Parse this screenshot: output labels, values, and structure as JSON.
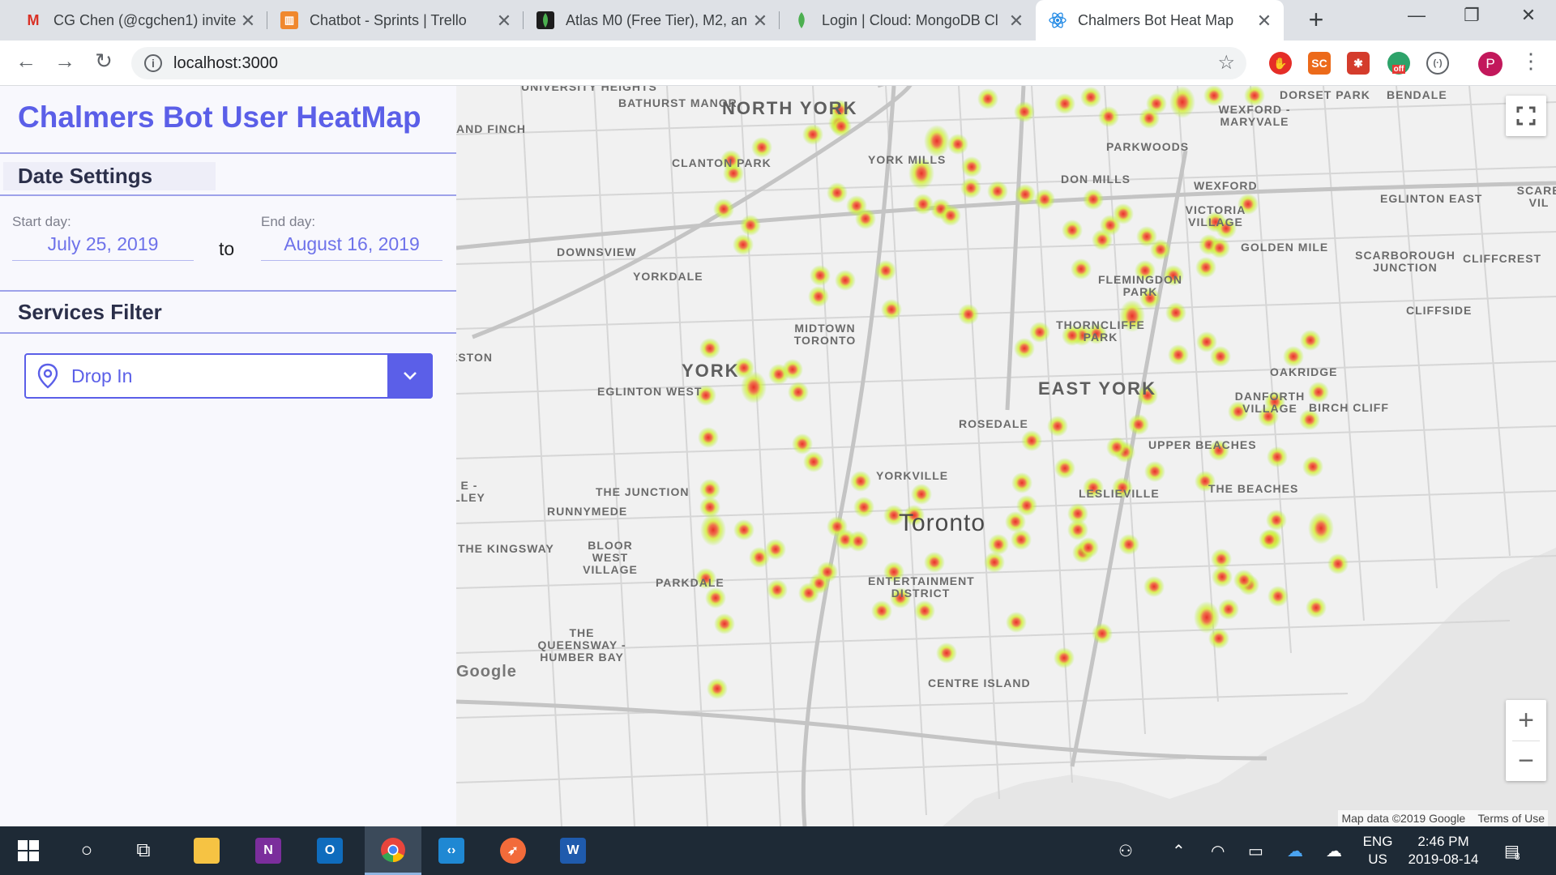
{
  "browser": {
    "tabs": [
      {
        "title": "CG Chen (@cgchen1) invite",
        "icon": "gmail-icon",
        "color": "#d93025"
      },
      {
        "title": "Chatbot - Sprints | Trello",
        "icon": "trello-icon",
        "color": "#f0882d"
      },
      {
        "title": "Atlas M0 (Free Tier), M2, an",
        "icon": "mongodb-leaf-icon",
        "color": "#4caf50"
      },
      {
        "title": "Login | Cloud: MongoDB Cl",
        "icon": "mongodb-leaf-icon",
        "color": "#4caf50"
      },
      {
        "title": "Chalmers Bot Heat Map",
        "icon": "react-icon",
        "color": "#61dafb"
      }
    ],
    "url": "localhost:3000",
    "profile_initial": "P",
    "extensions": [
      {
        "name": "adblock-icon",
        "label": "✋",
        "color": "#e52d27"
      },
      {
        "name": "sc-icon",
        "label": "SC",
        "color": "#ec6a1a"
      },
      {
        "name": "puzzle-extension-icon",
        "label": "✱",
        "color": "#d43c2c"
      },
      {
        "name": "off-extension-icon",
        "label": "off",
        "color": "#e53935"
      },
      {
        "name": "code-extension-icon",
        "label": "(·)",
        "color": "#ffffff"
      }
    ]
  },
  "app": {
    "title": "Chalmers Bot User HeatMap",
    "date_settings": {
      "heading": "Date Settings",
      "start_label": "Start day:",
      "start_value": "July 25, 2019",
      "to_label": "to",
      "end_label": "End day:",
      "end_value": "August 16, 2019"
    },
    "services_filter": {
      "heading": "Services Filter",
      "selected": "Drop In"
    },
    "colors": {
      "accent": "#5b5fe8",
      "heading": "#2b2f4a"
    }
  },
  "map": {
    "attribution": "Map data ©2019 Google",
    "terms": "Terms of Use",
    "zoom_in": "+",
    "zoom_out": "−",
    "labels": [
      "UNIVERSITY HEIGHTS",
      "BATHURST MANOR",
      "NORTH YORK",
      "DORSET PARK",
      "BENDALE",
      "AND FINCH",
      "WEXFORD - MARYVALE",
      "PARKWOODS",
      "CLANTON PARK",
      "YORK MILLS",
      "DON MILLS",
      "WEXFORD",
      "EGLINTON EAST",
      "SCARB VIL",
      "VICTORIA VILLAGE",
      "GOLDEN MILE",
      "DOWNSVIEW",
      "YORKDALE",
      "SCARBOROUGH JUNCTION",
      "CLIFFCREST",
      "FLEMINGDON PARK",
      "CLIFFSIDE",
      "MIDTOWN TORONTO",
      "THORNCLIFFE PARK",
      "ESTON",
      "YORK",
      "OAKRIDGE",
      "EGLINTON WEST",
      "EAST YORK",
      "DANFORTH VILLAGE",
      "BIRCH CLIFF",
      "ROSEDALE",
      "UPPER BEACHES",
      "YORKVILLE",
      "E - LLEY",
      "THE JUNCTION",
      "LESLIEVILLE",
      "THE BEACHES",
      "RUNNYMEDE",
      "Toronto",
      "THE KINGSWAY",
      "BLOOR WEST VILLAGE",
      "PARKDALE",
      "ENTERTAINMENT DISTRICT",
      "THE QUEENSWAY - HUMBER BAY",
      "CENTRE ISLAND",
      "Google"
    ]
  },
  "taskbar": {
    "apps": [
      {
        "name": "file-explorer-icon",
        "label": "",
        "color": "#f6c343"
      },
      {
        "name": "onenote-icon",
        "label": "N",
        "color": "#7b2e9c"
      },
      {
        "name": "outlook-icon",
        "label": "O",
        "color": "#0f6cbd"
      },
      {
        "name": "chrome-icon",
        "label": "",
        "color": "#e8453c"
      },
      {
        "name": "vscode-icon",
        "label": "",
        "color": "#1f88d3"
      },
      {
        "name": "postman-icon",
        "label": "",
        "color": "#f26b3a"
      },
      {
        "name": "word-icon",
        "label": "W",
        "color": "#1f5bad"
      }
    ],
    "lang_top": "ENG",
    "lang_bottom": "US",
    "time": "2:46 PM",
    "date": "2019-08-14",
    "notifications": "8"
  }
}
